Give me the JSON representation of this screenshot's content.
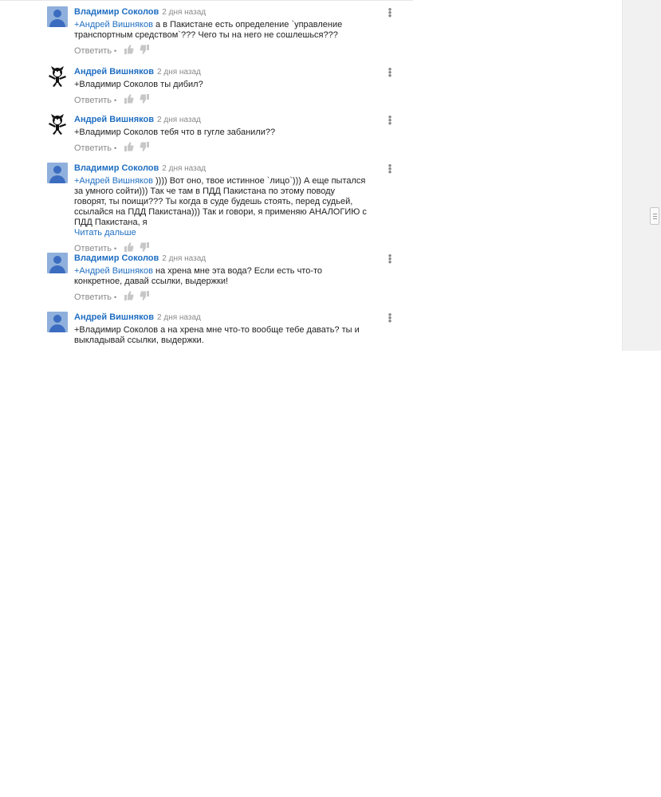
{
  "ui": {
    "reply_label": "Ответить",
    "bullet": "•",
    "kebab": "⋮"
  },
  "comments": [
    {
      "author": "Владимир Соколов",
      "time": "2 дня назад",
      "avatar": "default-avatar",
      "mention": "+Андрей Вишняков",
      "text": " а в Пакистане есть определение `управление транспортным средством`??? Чего ты на него не сошлешься???",
      "read_more": ""
    },
    {
      "author": "Андрей Вишняков",
      "time": "2 дня назад",
      "avatar": "cartoon-cat-avatar",
      "mention": "",
      "text": "+Владимир Соколов ты дибил?",
      "read_more": ""
    },
    {
      "author": "Андрей Вишняков",
      "time": "2 дня назад",
      "avatar": "cartoon-cat-avatar",
      "mention": "",
      "text": "+Владимир Соколов тебя что в гугле забанили??",
      "read_more": ""
    },
    {
      "author": "Владимир Соколов",
      "time": "2 дня назад",
      "avatar": "default-avatar",
      "mention": "+Андрей Вишняков",
      "text": " )))) Вот оно, твое истинное `лицо`))) А еще пытался за умного сойти))) Так че там в ПДД Пакистана по этому поводу говорят, ты поищи??? Ты когда в суде будешь стоять, перед судьей, ссылайся на ПДД Пакистана))) Так и говори, я применяю АНАЛОГИЮ с ПДД Пакистана, я",
      "read_more": "Читать дальше"
    },
    {
      "author": "Владимир Соколов",
      "time": "2 дня назад",
      "avatar": "default-avatar",
      "mention": "+Андрей Вишняков",
      "text": " на хрена мне эта вода? Если есть что-то конкретное, давай ссылки, выдержки!",
      "read_more": ""
    },
    {
      "author": "Андрей Вишняков",
      "time": "2 дня назад",
      "avatar": "default-avatar",
      "mention": "",
      "text": "+Владимир Соколов а на хрена мне что-то вообще тебе давать? ты и выкладывай ссылки, выдержки.",
      "read_more": ""
    }
  ]
}
